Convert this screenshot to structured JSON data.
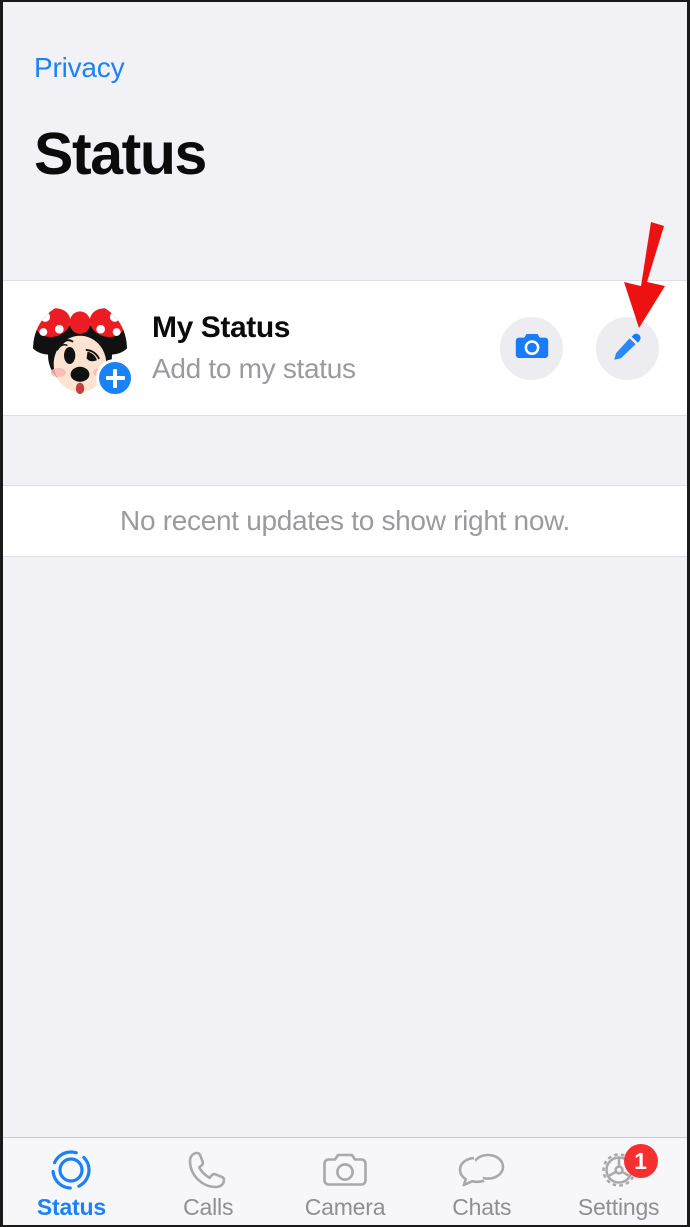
{
  "header": {
    "back_link": "Privacy",
    "title": "Status"
  },
  "status_row": {
    "title": "My Status",
    "subtitle": "Add to my status",
    "avatar_alt": "minnie-mouse-avatar",
    "add_badge_icon": "plus-icon",
    "camera_button_icon": "camera-icon",
    "edit_button_icon": "pencil-icon"
  },
  "annotation": {
    "arrow_icon": "red-down-arrow",
    "arrow_color": "#ee1111",
    "points_to": "edit-status-button"
  },
  "empty_state": {
    "message": "No recent updates to show right now."
  },
  "tabbar": {
    "items": [
      {
        "label": "Status",
        "icon": "status-rings-icon",
        "active": true,
        "badge": ""
      },
      {
        "label": "Calls",
        "icon": "phone-icon",
        "active": false,
        "badge": ""
      },
      {
        "label": "Camera",
        "icon": "camera-outline-icon",
        "active": false,
        "badge": ""
      },
      {
        "label": "Chats",
        "icon": "chat-bubbles-icon",
        "active": false,
        "badge": ""
      },
      {
        "label": "Settings",
        "icon": "gear-icon",
        "active": false,
        "badge": "1"
      }
    ]
  },
  "colors": {
    "accent_blue": "#1a82f7",
    "background_gray": "#f1f1f6",
    "card_white": "#ffffff",
    "muted_text": "#9a9aa0",
    "badge_red": "#f62f30",
    "annotation_red": "#ee1111"
  }
}
